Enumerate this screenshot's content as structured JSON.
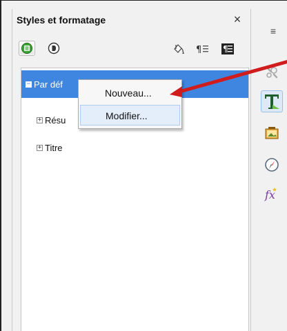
{
  "panel": {
    "title": "Styles et formatage",
    "close_glyph": "×"
  },
  "toolbar": {
    "paragraph_styles_icon": "paragraph-styles-icon",
    "character_styles_icon": "character-styles-icon",
    "fill_format_icon": "fill-format-icon",
    "new_style_icon": "new-style-from-selection-icon",
    "update_style_icon": "update-style-icon"
  },
  "tree": {
    "items": [
      {
        "label": "Par déf",
        "expander": "−",
        "selected": true
      },
      {
        "label": "Résu",
        "expander": "+"
      },
      {
        "label": "Titre",
        "expander": "+"
      }
    ]
  },
  "context_menu": {
    "new_label": "Nouveau...",
    "modify_label": "Modifier..."
  },
  "sidebar": {
    "menu_glyph": "≡",
    "icons": [
      "tools-icon",
      "styles-icon",
      "gallery-icon",
      "navigator-icon",
      "functions-icon"
    ]
  },
  "colors": {
    "selection": "#3f86e0",
    "arrow": "#d01c1c",
    "menu_hover": "#e4eefb"
  }
}
